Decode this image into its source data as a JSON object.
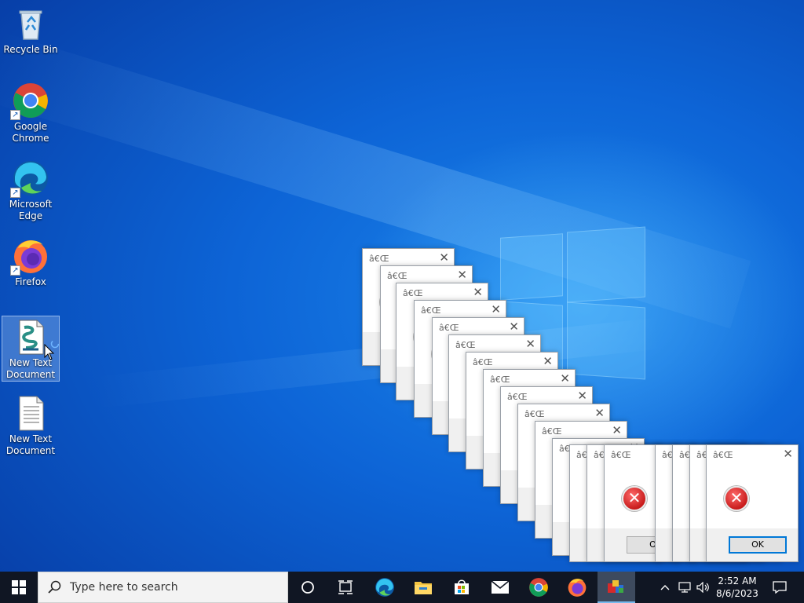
{
  "desktop": {
    "icons": [
      {
        "label": "Recycle Bin",
        "icon": "recycle-bin-icon"
      },
      {
        "label": "Google Chrome",
        "icon": "chrome-icon"
      },
      {
        "label": "Microsoft Edge",
        "icon": "edge-icon"
      },
      {
        "label": "Firefox",
        "icon": "firefox-icon"
      },
      {
        "label": "New Text Document",
        "icon": "script-file-icon",
        "selected": true
      },
      {
        "label": "New Text Document",
        "icon": "text-file-icon"
      }
    ]
  },
  "dialogs": {
    "title": "â€Œ",
    "ok_label": "OK",
    "ok_label_partial": "O",
    "error_icon": "error-icon"
  },
  "taskbar": {
    "search_placeholder": "Type here to search",
    "pinned": [
      "cortana-icon",
      "task-view-icon",
      "edge-icon",
      "file-explorer-icon",
      "store-icon",
      "mail-icon",
      "chrome-icon",
      "firefox-icon",
      "running-app-icon"
    ],
    "tray": {
      "time": "2:52 AM",
      "date": "8/6/2023"
    }
  },
  "colors": {
    "wallpaper_blue": "#0d64d6",
    "taskbar": "#101623",
    "error_red": "#c81c1c",
    "accent": "#0078d7"
  }
}
